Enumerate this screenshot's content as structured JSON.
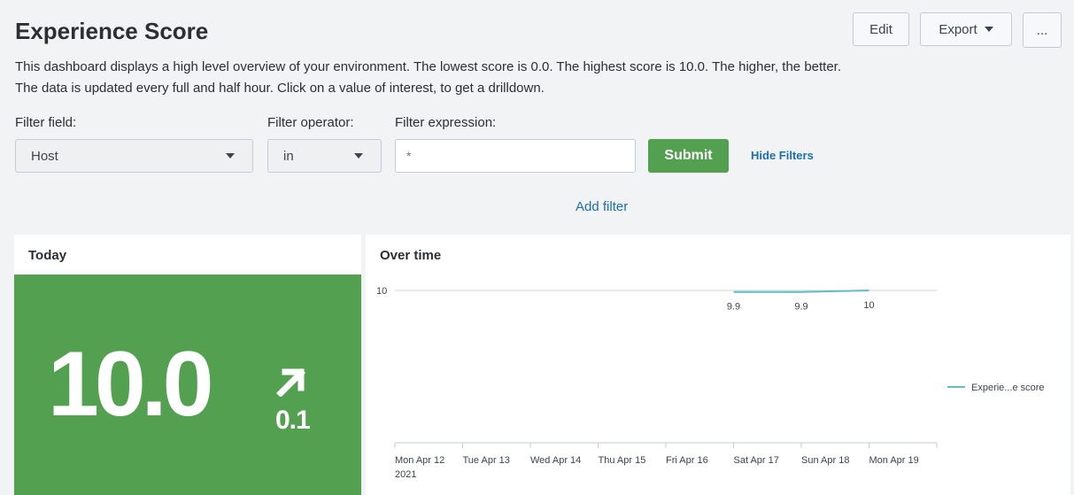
{
  "header": {
    "title": "Experience Score",
    "edit_label": "Edit",
    "export_label": "Export",
    "more_label": "..."
  },
  "description": "This dashboard displays a high level overview of your environment. The lowest score is 0.0. The highest score is 10.0. The higher, the better. The data is updated every full and half hour. Click on a value of interest, to get a drilldown.",
  "filters": {
    "field_label": "Filter field:",
    "field_value": "Host",
    "operator_label": "Filter operator:",
    "operator_value": "in",
    "expression_label": "Filter expression:",
    "expression_value": "*",
    "submit_label": "Submit",
    "hide_filters_label": "Hide Filters",
    "add_filter_label": "Add filter"
  },
  "today_panel": {
    "title": "Today",
    "value": "10.0",
    "trend_value": "0.1",
    "trend_direction": "up",
    "background_color": "#53a051"
  },
  "overtime_panel": {
    "title": "Over time"
  },
  "chart_data": {
    "type": "line",
    "title": "Over time",
    "x": [
      "Mon Apr 12",
      "Tue Apr 13",
      "Wed Apr 14",
      "Thu Apr 15",
      "Fri Apr 16",
      "Sat Apr 17",
      "Sun Apr 18",
      "Mon Apr 19"
    ],
    "x_sublabel": "2021",
    "y_ticks": [
      "10"
    ],
    "series": [
      {
        "name": "Experie...e score",
        "color": "#65bcc9",
        "values": [
          null,
          null,
          null,
          null,
          null,
          9.9,
          9.9,
          10
        ]
      }
    ],
    "data_labels": [
      "9.9",
      "9.9",
      "10"
    ],
    "legend": "right"
  }
}
